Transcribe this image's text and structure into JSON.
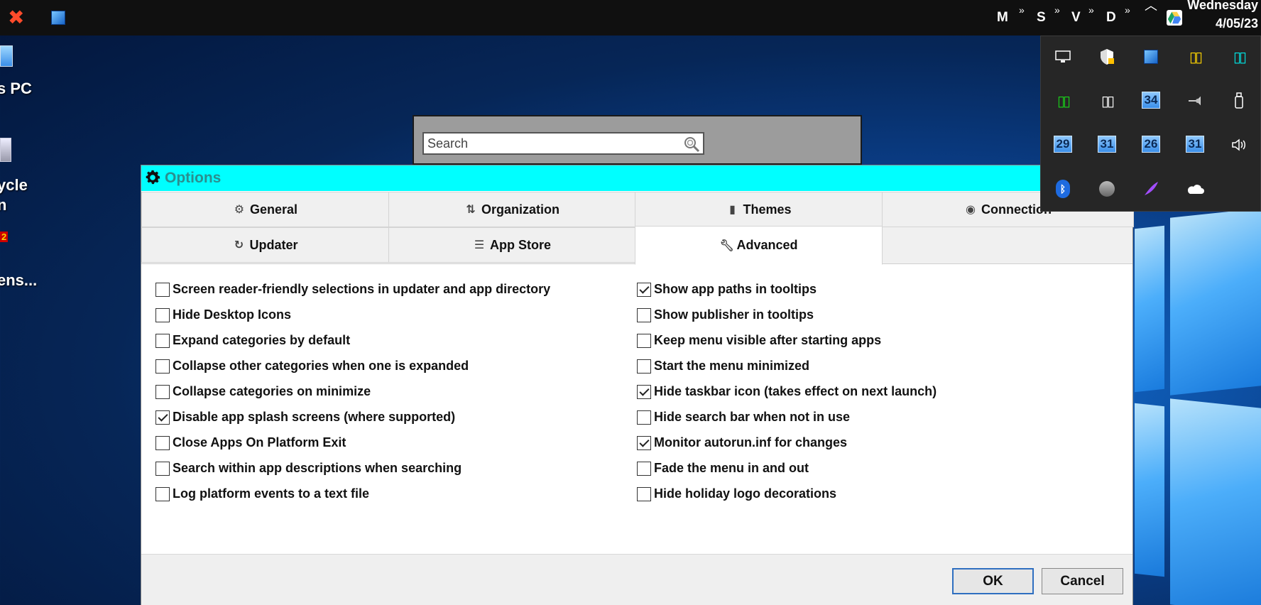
{
  "taskbar": {
    "drive_letters": [
      "M",
      "S",
      "V",
      "D"
    ],
    "chevron": "»",
    "clock": {
      "day": "Wednesday",
      "date": "4/05/23"
    },
    "icons": [
      "close-x-icon",
      "app-window-icon",
      "google-drive-icon",
      "chevron-up-icon"
    ]
  },
  "desktop": {
    "icons": [
      {
        "label": "s PC",
        "icon": "computer-icon"
      },
      {
        "label": "ycle",
        "label2": "n",
        "icon": "recycle-bin-icon"
      },
      {
        "label": "ens...",
        "icon": "app-shortcut-icon",
        "badge": "2"
      }
    ]
  },
  "search_window": {
    "placeholder": "Search"
  },
  "dialog": {
    "title": "Options",
    "tabs": [
      {
        "label": "General",
        "icon": "gear-icon"
      },
      {
        "label": "Organization",
        "icon": "sort-icon"
      },
      {
        "label": "Themes",
        "icon": "theme-icon"
      },
      {
        "label": "Connection",
        "icon": "connection-icon"
      },
      {
        "label": "Updater",
        "icon": "refresh-icon"
      },
      {
        "label": "App Store",
        "icon": "list-icon"
      },
      {
        "label": "Advanced",
        "icon": "wrench-icon",
        "active": true
      }
    ],
    "left_options": [
      {
        "label": "Screen reader-friendly selections in updater and app directory",
        "checked": false
      },
      {
        "label": "Hide Desktop Icons",
        "checked": false
      },
      {
        "label": "Expand categories by default",
        "checked": false
      },
      {
        "label": "Collapse other categories when one is expanded",
        "checked": false
      },
      {
        "label": "Collapse categories on minimize",
        "checked": false
      },
      {
        "label": "Disable app splash screens (where supported)",
        "checked": true
      },
      {
        "label": "Close Apps On Platform Exit",
        "checked": false
      },
      {
        "label": "Search within app descriptions when searching",
        "checked": false
      },
      {
        "label": "Log platform events to a text file",
        "checked": false
      }
    ],
    "right_options": [
      {
        "label": "Show app paths in tooltips",
        "checked": true
      },
      {
        "label": "Show publisher in tooltips",
        "checked": false
      },
      {
        "label": "Keep menu visible after starting apps",
        "checked": false
      },
      {
        "label": "Start the menu minimized",
        "checked": false
      },
      {
        "label": "Hide taskbar icon (takes effect on next launch)",
        "checked": true
      },
      {
        "label": "Hide search bar when not in use",
        "checked": false
      },
      {
        "label": "Monitor autorun.inf for changes",
        "checked": true
      },
      {
        "label": "Fade the menu in and out",
        "checked": false
      },
      {
        "label": "Hide holiday logo decorations",
        "checked": false
      }
    ],
    "buttons": {
      "ok": "OK",
      "cancel": "Cancel"
    }
  },
  "tray": {
    "numbers": [
      "34",
      "29",
      "31",
      "26",
      "31"
    ],
    "colors": {
      "yellow": "#ffd400",
      "cyan": "#00e5e5",
      "green": "#19d419",
      "white": "#ffffff"
    }
  },
  "colors": {
    "titlebar": "#00ffff",
    "title_text": "#2a8f8f",
    "taskbar": "#101010",
    "ok_border": "#2f6fc0"
  }
}
